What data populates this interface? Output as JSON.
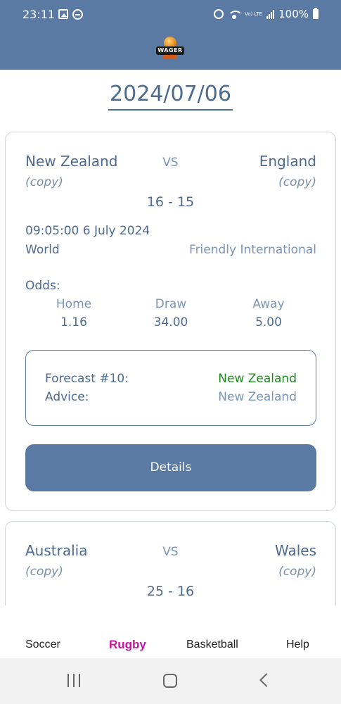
{
  "status_bar": {
    "time": "23:11",
    "battery": "100%",
    "network_label": "Vo) LTE"
  },
  "date": "2024/07/06",
  "matches": [
    {
      "home_team": "New Zealand",
      "away_team": "England",
      "vs": "VS",
      "home_copy": "(copy)",
      "away_copy": "(copy)",
      "score": "16 - 15",
      "kickoff": "09:05:00  6 July 2024",
      "region": "World",
      "competition": "Friendly International",
      "odds_label": "Odds:",
      "odds": {
        "home_label": "Home",
        "home": "1.16",
        "draw_label": "Draw",
        "draw": "34.00",
        "away_label": "Away",
        "away": "5.00"
      },
      "forecast_label": "Forecast #10:",
      "forecast_value": "New Zealand",
      "advice_label": "Advice:",
      "advice_value": "New Zealand",
      "details_label": "Details"
    },
    {
      "home_team": "Australia",
      "away_team": "Wales",
      "vs": "VS",
      "home_copy": "(copy)",
      "away_copy": "(copy)",
      "score": "25 - 16"
    }
  ],
  "tabs": [
    {
      "label": "Soccer",
      "active": false
    },
    {
      "label": "Rugby",
      "active": true
    },
    {
      "label": "Basketball",
      "active": false
    },
    {
      "label": "Help",
      "active": false
    }
  ],
  "logo_text": "WAGER",
  "colors": {
    "primary": "#5b7aa3",
    "text": "#4d6a8f",
    "muted": "#7a95b6",
    "forecast_green": "#1f8a1f",
    "active_tab": "#c2189b"
  }
}
